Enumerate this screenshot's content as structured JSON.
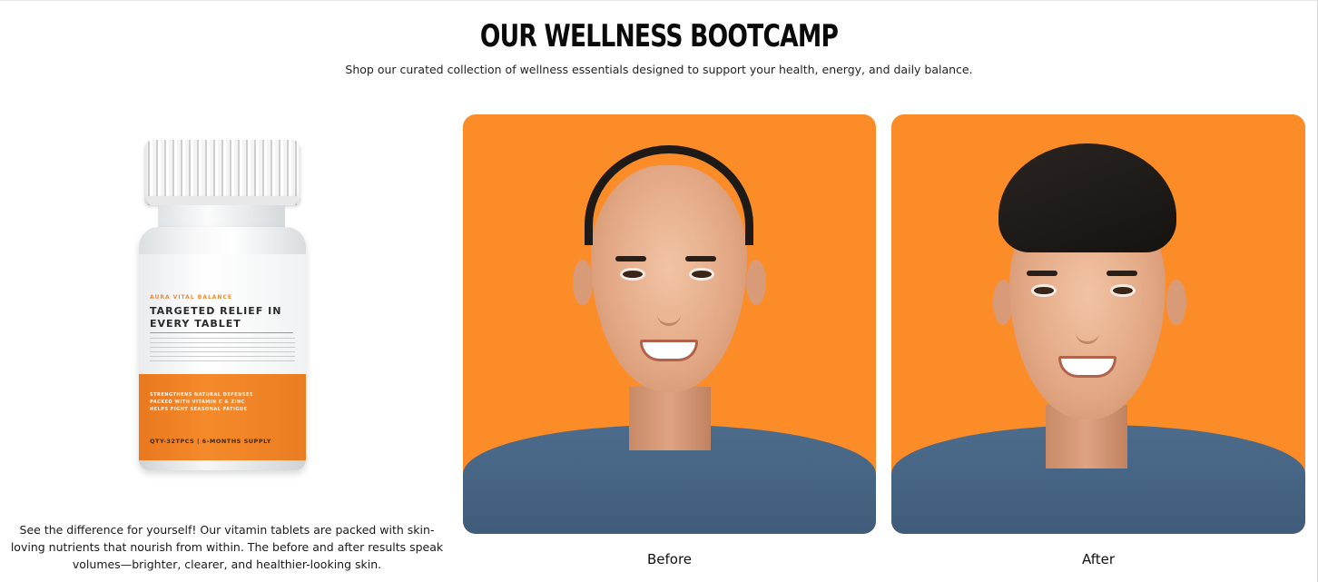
{
  "header": {
    "title": "OUR WELLNESS BOOTCAMP",
    "subtitle": "Shop our curated collection of wellness essentials designed to support your health, energy, and daily balance."
  },
  "product": {
    "brand": "AURA VITAL BALANCE",
    "title": "TARGETED RELIEF IN EVERY TABLET",
    "benefits": [
      "STRENGTHENS NATURAL DEFENSES",
      "PACKED WITH VITAMIN C & ZINC",
      "HELPS FIGHT SEASONAL FATIGUE"
    ],
    "supply": "QTY-32TPCS | 6-MONTHS SUPPLY",
    "description": "See the difference for yourself! Our vitamin tablets are packed with skin-loving nutrients that nourish from within. The before and after results speak volumes—brighter, clearer, and healthier-looking skin."
  },
  "comparison": {
    "before_caption": "Before",
    "after_caption": "After",
    "background_color": "#fb8c28"
  }
}
